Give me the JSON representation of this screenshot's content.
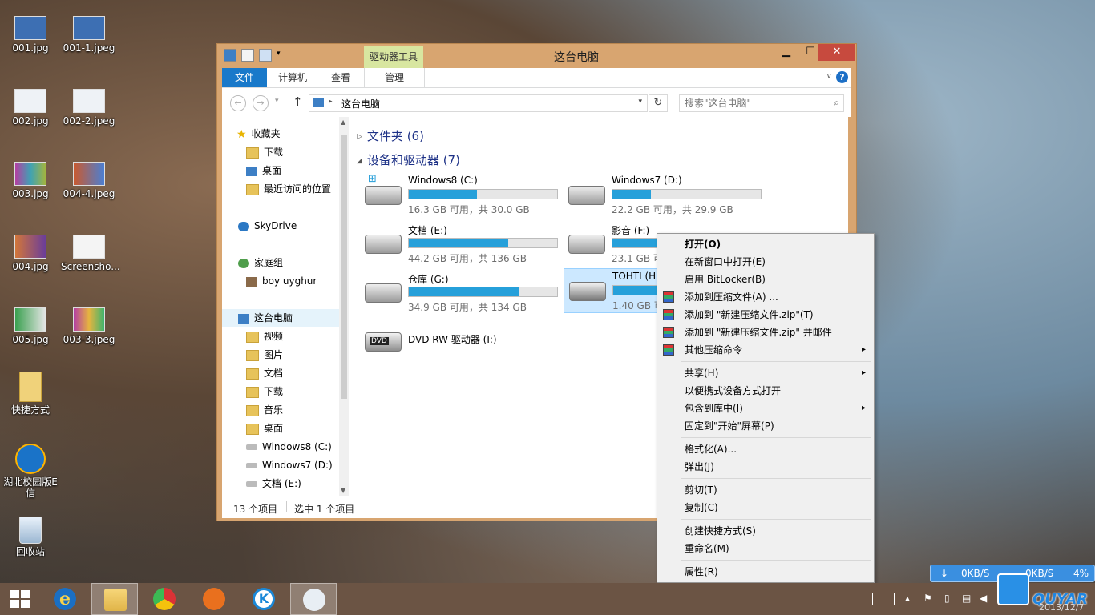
{
  "desktop": {
    "icons": [
      {
        "label": "001.jpg"
      },
      {
        "label": "001-1.jpeg"
      },
      {
        "label": "002.jpg"
      },
      {
        "label": "002-2.jpeg"
      },
      {
        "label": "003.jpg"
      },
      {
        "label": "004-4.jpeg"
      },
      {
        "label": "004.jpg"
      },
      {
        "label": "Screensho..."
      },
      {
        "label": "005.jpg"
      },
      {
        "label": "003-3.jpeg"
      },
      {
        "label": "快捷方式"
      },
      {
        "label": "湖北校园版E信"
      },
      {
        "label": "回收站"
      }
    ]
  },
  "window": {
    "title": "这台电脑",
    "context_tab_group": "驱动器工具",
    "tabs": [
      "文件",
      "计算机",
      "查看",
      "管理"
    ],
    "address": "这台电脑",
    "search_placeholder": "搜索\"这台电脑\"",
    "nav": [
      {
        "label": "收藏夹",
        "icon": "star-icon"
      },
      {
        "label": "下载",
        "icon": "folder-icon"
      },
      {
        "label": "桌面",
        "icon": "desktop-icon"
      },
      {
        "label": "最近访问的位置",
        "icon": "recent-icon"
      },
      {
        "label": "SkyDrive",
        "icon": "cloud-icon"
      },
      {
        "label": "家庭组",
        "icon": "homegroup-icon"
      },
      {
        "label": "boy uyghur",
        "icon": "user-icon"
      },
      {
        "label": "这台电脑",
        "icon": "pc-icon"
      },
      {
        "label": "视频",
        "icon": "folder-icon"
      },
      {
        "label": "图片",
        "icon": "folder-icon"
      },
      {
        "label": "文档",
        "icon": "folder-icon"
      },
      {
        "label": "下载",
        "icon": "folder-icon"
      },
      {
        "label": "音乐",
        "icon": "folder-icon"
      },
      {
        "label": "桌面",
        "icon": "folder-icon"
      },
      {
        "label": "Windows8 (C:)",
        "icon": "drive-icon"
      },
      {
        "label": "Windows7 (D:)",
        "icon": "drive-icon"
      },
      {
        "label": "文档 (E:)",
        "icon": "drive-icon"
      }
    ],
    "groups": {
      "folders": "文件夹 (6)",
      "devices": "设备和驱动器 (7)"
    },
    "drives": [
      {
        "name": "Windows8 (C:)",
        "free": "16.3 GB 可用，共 30.0 GB",
        "used_fraction": 0.46
      },
      {
        "name": "Windows7 (D:)",
        "free": "22.2 GB 可用，共 29.9 GB",
        "used_fraction": 0.26
      },
      {
        "name": "文档 (E:)",
        "free": "44.2 GB 可用，共 136 GB",
        "used_fraction": 0.67
      },
      {
        "name": "影音 (F:)",
        "free": "23.1 GB 可",
        "used_fraction": 0.8
      },
      {
        "name": "仓库 (G:)",
        "free": "34.9 GB 可用，共 134 GB",
        "used_fraction": 0.74
      },
      {
        "name": "TOHTI (H:",
        "free": "1.40 GB 可",
        "used_fraction": 0.3
      },
      {
        "name": "DVD RW 驱动器 (I:)"
      }
    ],
    "status": {
      "count": "13 个项目",
      "selected": "选中 1 个项目"
    }
  },
  "context_menu": {
    "items": [
      {
        "label": "打开(O)",
        "bold": true
      },
      {
        "label": "在新窗口中打开(E)"
      },
      {
        "label": "启用 BitLocker(B)"
      },
      {
        "label": "添加到压缩文件(A) ...",
        "icon": "winrar-icon"
      },
      {
        "label": "添加到 \"新建压缩文件.zip\"(T)",
        "icon": "winrar-icon"
      },
      {
        "label": "添加到 \"新建压缩文件.zip\" 并邮件",
        "icon": "winrar-icon"
      },
      {
        "label": "其他压缩命令",
        "icon": "winrar-icon",
        "submenu": true
      },
      {
        "label": "共享(H)",
        "submenu": true
      },
      {
        "label": "以便携式设备方式打开"
      },
      {
        "label": "包含到库中(I)",
        "submenu": true
      },
      {
        "label": "固定到\"开始\"屏幕(P)"
      },
      {
        "label": "格式化(A)..."
      },
      {
        "label": "弹出(J)"
      },
      {
        "label": "剪切(T)"
      },
      {
        "label": "复制(C)"
      },
      {
        "label": "创建快捷方式(S)"
      },
      {
        "label": "重命名(M)"
      },
      {
        "label": "属性(R)"
      }
    ]
  },
  "netmon": {
    "down": "0KB/S",
    "up": "0KB/S",
    "pct": "4%"
  },
  "brand": {
    "text": "QUYAR"
  },
  "clock": {
    "date": "2013/12/7"
  }
}
